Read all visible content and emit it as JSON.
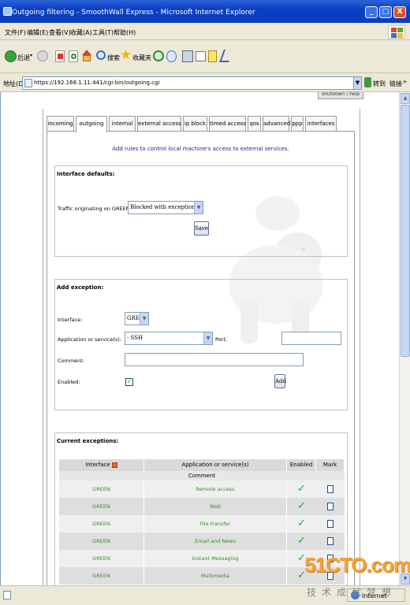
{
  "window": {
    "title": "Outgoing filtering - SmoothWall Express - Microsoft Internet Explorer",
    "minimize": "_",
    "maximize": "□",
    "close": "X"
  },
  "menu": [
    "文件(F)",
    "编辑(E)",
    "查看(V)",
    "收藏(A)",
    "工具(T)",
    "帮助(H)"
  ],
  "toolbar": {
    "back_label": "后退",
    "search_label": "搜索",
    "favorites_label": "收藏夹"
  },
  "address": {
    "label": "地址(D)",
    "url": "https://192.168.1.11:441/cgi-bin/outgoing.cgi",
    "go_label": "转到",
    "links_label": "链接"
  },
  "status": {
    "zone_label": "Internet"
  },
  "watermark": {
    "main": "51CTO.com",
    "sub": "技术成就梦想"
  },
  "page": {
    "shutdown_help": "shutdown | help",
    "tabs": [
      "incoming",
      "outgoing",
      "internal",
      "external access",
      "ip block",
      "timed access",
      "qos",
      "advanced",
      "ppp",
      "interfaces"
    ],
    "active_tab": "outgoing",
    "intro": "Add rules to control local machine's access to external services.",
    "defaults": {
      "title": "Interface defaults:",
      "traffic_label": "Traffic originating on GREEN is:",
      "traffic_value": "Blocked with exceptions",
      "save_label": "Save"
    },
    "exception": {
      "title": "Add exception:",
      "interface_label": "Interface:",
      "interface_value": "GREEN",
      "app_label": "Application or service(s):",
      "app_value": "- SSH",
      "port_label": "Port:",
      "port_value": "",
      "comment_label": "Comment:",
      "comment_value": "",
      "enabled_label": "Enabled:",
      "enabled_checked": true,
      "add_label": "Add"
    },
    "current": {
      "title": "Current exceptions:",
      "headers": [
        "Interface",
        "Application or service(s)",
        "Enabled",
        "Mark"
      ],
      "comment_header": "Comment",
      "rows": [
        {
          "interface": "GREEN",
          "service": "Remote access",
          "enabled": "✓"
        },
        {
          "interface": "GREEN",
          "service": "Web",
          "enabled": "✓"
        },
        {
          "interface": "GREEN",
          "service": "File transfer",
          "enabled": "✓"
        },
        {
          "interface": "GREEN",
          "service": "Email and News",
          "enabled": "✓"
        },
        {
          "interface": "GREEN",
          "service": "Instant Messaging",
          "enabled": "✓"
        },
        {
          "interface": "GREEN",
          "service": "Multimedia",
          "enabled": "✓"
        }
      ]
    }
  },
  "icons": {
    "bear": "polar-bear-watermark",
    "back": "back-arrow-icon",
    "forward": "forward-arrow-icon",
    "stop": "stop-icon",
    "refresh": "refresh-icon",
    "home": "home-icon",
    "search": "search-icon",
    "favorites": "star-icon",
    "history": "history-icon"
  },
  "colors": {
    "titlebar": "#0a40c2",
    "chrome": "#ece9d8",
    "link_green": "#3b8a2e",
    "intro_blue": "#1a2a8a",
    "watermark_orange": "#f3a43a"
  }
}
